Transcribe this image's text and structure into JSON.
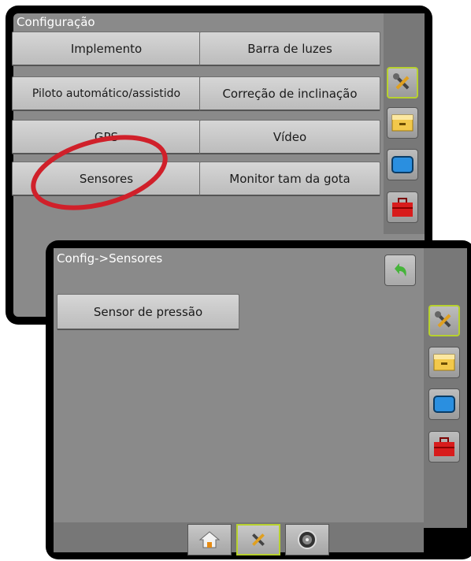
{
  "back_screen": {
    "title": "Configuração",
    "buttons": [
      {
        "label": "Implemento"
      },
      {
        "label": "Barra de luzes"
      },
      {
        "label": "Piloto automático/assistido"
      },
      {
        "label": "Correção de inclinação"
      },
      {
        "label": "GPS"
      },
      {
        "label": "Vídeo"
      },
      {
        "label": "Sensores"
      },
      {
        "label": "Monitor tam da gota"
      }
    ],
    "sidebar_icons": [
      "tools-icon",
      "storage-icon",
      "display-icon",
      "toolbox-icon"
    ]
  },
  "front_screen": {
    "title": "Config->Sensores",
    "buttons": [
      {
        "label": "Sensor de pressão"
      }
    ],
    "sidebar_icons": [
      "tools-icon",
      "storage-icon",
      "display-icon",
      "toolbox-icon"
    ],
    "bottom_nav": [
      "home-icon",
      "tools-icon",
      "gauge-icon"
    ]
  },
  "colors": {
    "highlight_circle": "#d0202a",
    "active_border": "#b7d12e",
    "panel_gray": "#8a8a8a"
  }
}
